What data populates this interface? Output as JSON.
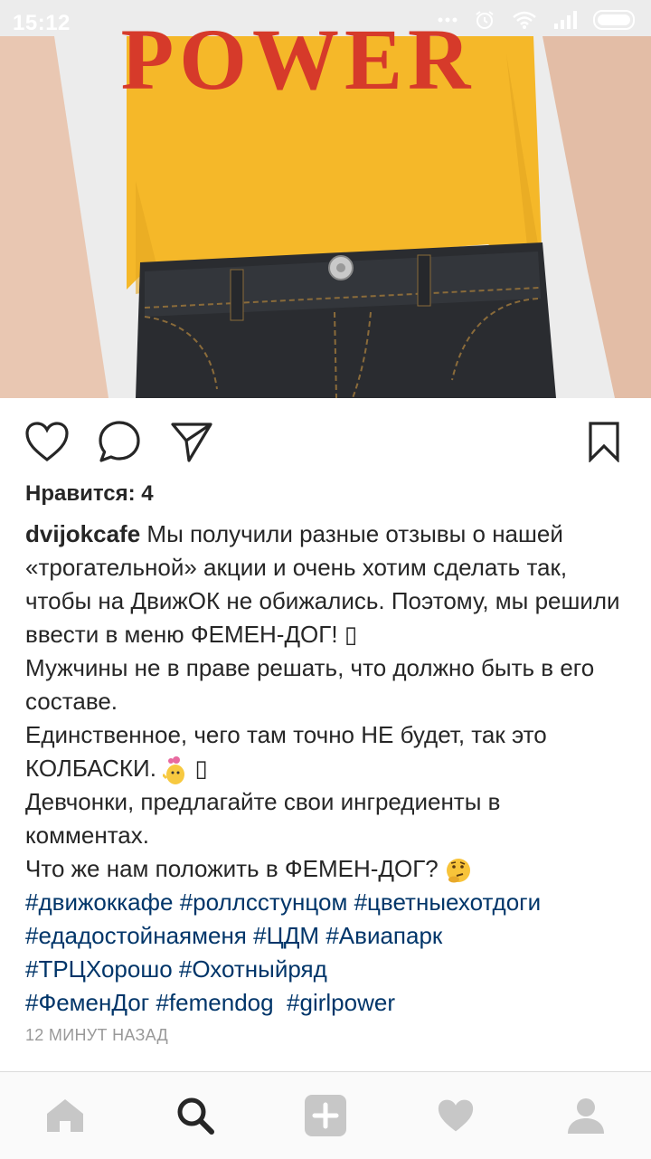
{
  "status_bar": {
    "time": "15:12",
    "icons": [
      "dots-icon",
      "alarm-icon",
      "wifi-icon",
      "signal-icon",
      "battery-icon"
    ]
  },
  "post": {
    "image_description_icon": "photo",
    "shirt_text": "POWER",
    "colors": {
      "shirt": "#f5b829",
      "jeans": "#2a2c30",
      "skin": "#e8c4ae",
      "background": "#ececec"
    }
  },
  "actions": {
    "icons": [
      "heart-icon",
      "comment-icon",
      "share-icon",
      "bookmark-icon"
    ]
  },
  "likes_text": "Нравится: 4",
  "caption": {
    "username": "dvijokcafe",
    "line1": "Мы получили разные отзывы о нашей «трогательной» акции и очень хотим сделать так, чтобы на ДвижОК не обижались. Поэтому, мы решили ввести в меню ФЕМЕН-ДОГ! ",
    "line1_glyph": "▯",
    "line2": "Мужчины не в праве решать, что должно быть в его составе.",
    "line3": "Единственное, чего там точно НЕ будет, так это КОЛБАСКИ. ",
    "line3_glyph": "▯",
    "line4": "Девчонки, предлагайте свои ингредиенты в комментах.",
    "line5": "Что же нам положить в ФЕМЕН-ДОГ? ",
    "hashtags": [
      "#движоккафе",
      "#роллсстунцом",
      "#цветныехотдоги",
      "#едадостойнаяменя",
      "#ЦДМ",
      "#Авиапарк",
      "#ТРЦХорошо",
      "#Охотныйряд",
      "#ФеменДог",
      "#femendog",
      "#girlpower"
    ]
  },
  "timestamp": "12 МИНУТ НАЗАД",
  "nav": {
    "icons": [
      "home-icon",
      "search-icon",
      "add-icon",
      "activity-heart-icon",
      "profile-icon"
    ],
    "colors": {
      "active": "#262626",
      "inactive": "#c7c7c7"
    }
  }
}
